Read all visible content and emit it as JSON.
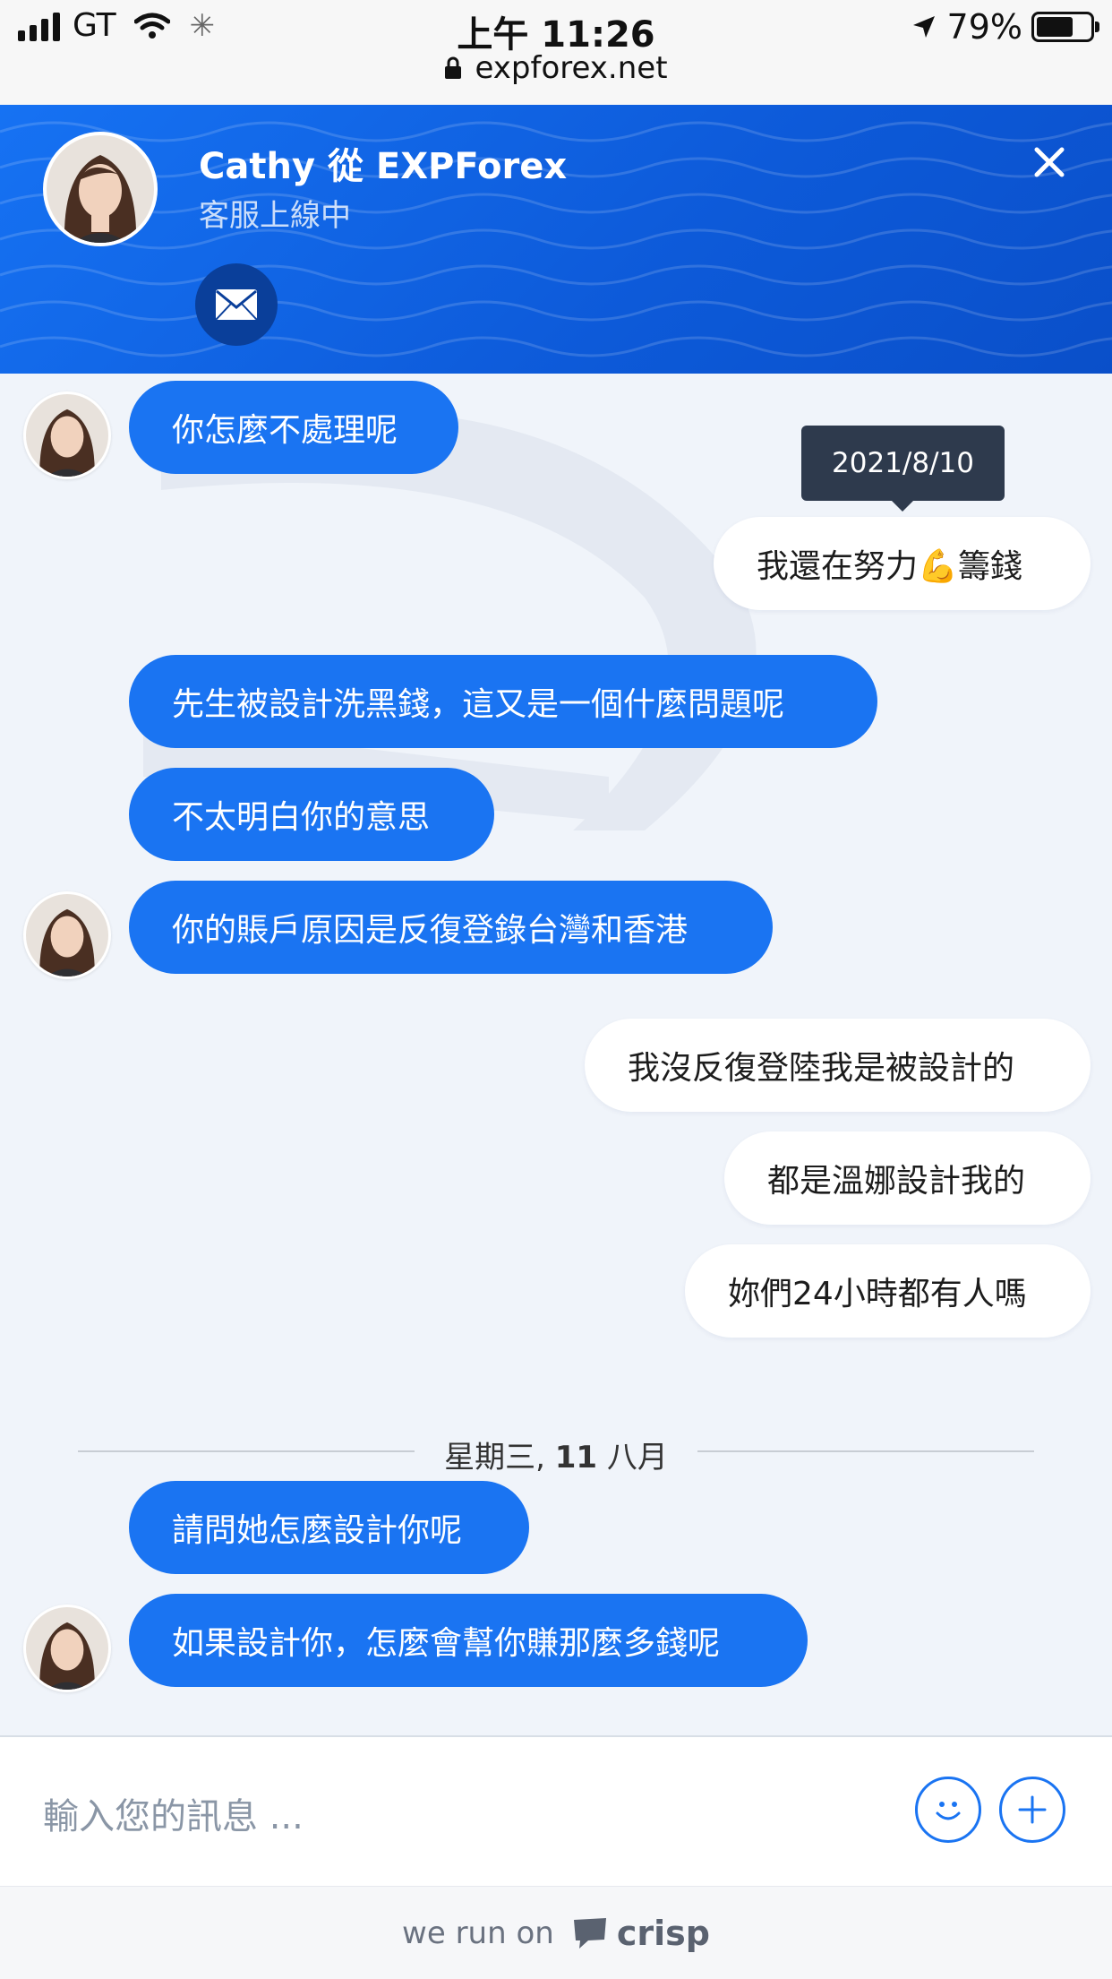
{
  "status_bar": {
    "carrier": "GT",
    "time": "上午 11:26",
    "battery": "79%",
    "battery_level": 0.79,
    "url": "expforex.net"
  },
  "header": {
    "title": "Cathy 從 EXPForex",
    "status": "客服上線中"
  },
  "messages": {
    "tooltip_date": "2021/8/10",
    "m1": "你怎麼不處理呢",
    "m2": "我還在努力💪籌錢",
    "m3": "先生被設計洗黑錢，這又是一個什麼問題呢",
    "m4": "不太明白你的意思",
    "m5": "你的賬戶原因是反復登錄台灣和香港",
    "m6": "我沒反復登陸我是被設計的",
    "m7": "都是溫娜設計我的",
    "m8": "妳們24小時都有人嗎",
    "divider_day": "星期三,",
    "divider_date": "11",
    "divider_month": "八月",
    "m9": "請問她怎麼設計你呢",
    "m10": "如果設計你，怎麼會幫你賺那麼多錢呢"
  },
  "composer": {
    "placeholder": "輸入您的訊息 ..."
  },
  "footer": {
    "run_on": "we run on",
    "brand": "crisp"
  },
  "colors": {
    "accent": "#1a74f2",
    "header_bg": "#0d5ad9",
    "page_bg": "#f0f4fa"
  }
}
